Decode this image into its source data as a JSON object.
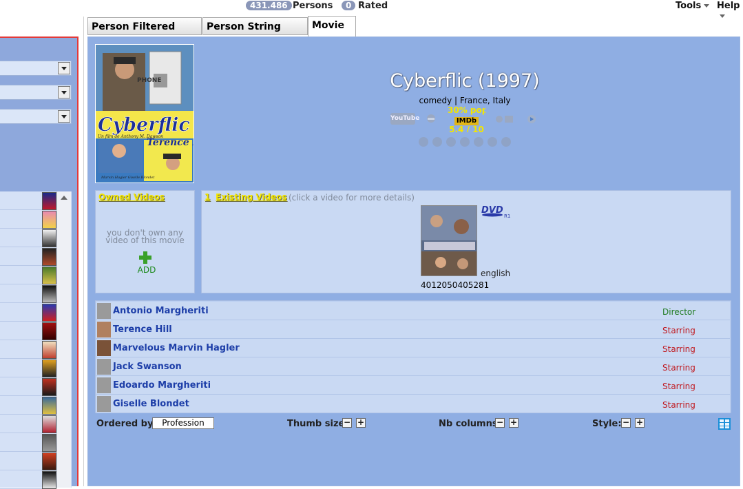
{
  "topbar": {
    "persons_count": "431.486",
    "persons_label": "Persons",
    "rated_count": "0",
    "rated_label": "Rated",
    "tools_label": "Tools",
    "help_label": "Help"
  },
  "tabs": [
    {
      "label": "Person Filtered Search"
    },
    {
      "label": "Person String Search"
    },
    {
      "label": "Movie"
    }
  ],
  "movie": {
    "title": "Cyberflic (1997)",
    "subtitle": "comedy | France, Italy",
    "imdb_popularity": "30% pop",
    "imdb_logo": "IMDb",
    "imdb_rating": "5.4 / 10",
    "youtube_label": "YouTube",
    "poster_title": "Cyberflic",
    "poster_line": "Un film de Anthony M. Dawson",
    "poster_name": "Terence Hill",
    "poster_credits": "Marvin Hagler\nGiselle Blondet",
    "poster_phone": "PHONE"
  },
  "owned": {
    "title": "Owned Videos",
    "empty_text": "you don't own any video of this movie",
    "add_label": "ADD"
  },
  "existing": {
    "count": "1",
    "title": "Existing Videos",
    "hint": "(click a video for more details)",
    "format_logo": "DVD",
    "region": "R1",
    "language": "english",
    "barcode": "4012050405281"
  },
  "cast": [
    {
      "name": "Antonio Margheriti",
      "role": "Director",
      "role_color": "#1f7a1f"
    },
    {
      "name": "Terence Hill",
      "role": "Starring",
      "role_color": "#c0181e"
    },
    {
      "name": "Marvelous Marvin Hagler",
      "role": "Starring",
      "role_color": "#c0181e"
    },
    {
      "name": "Jack Swanson",
      "role": "Starring",
      "role_color": "#c0181e"
    },
    {
      "name": "Edoardo Margheriti",
      "role": "Starring",
      "role_color": "#c0181e"
    },
    {
      "name": "Giselle Blondet",
      "role": "Starring",
      "role_color": "#c0181e"
    }
  ],
  "bottom": {
    "ordered_label": "Ordered by:",
    "ordered_value": "Profession",
    "thumb_label": "Thumb size:",
    "columns_label": "Nb columns:",
    "style_label": "Style:",
    "minus": "−",
    "plus": "+"
  }
}
